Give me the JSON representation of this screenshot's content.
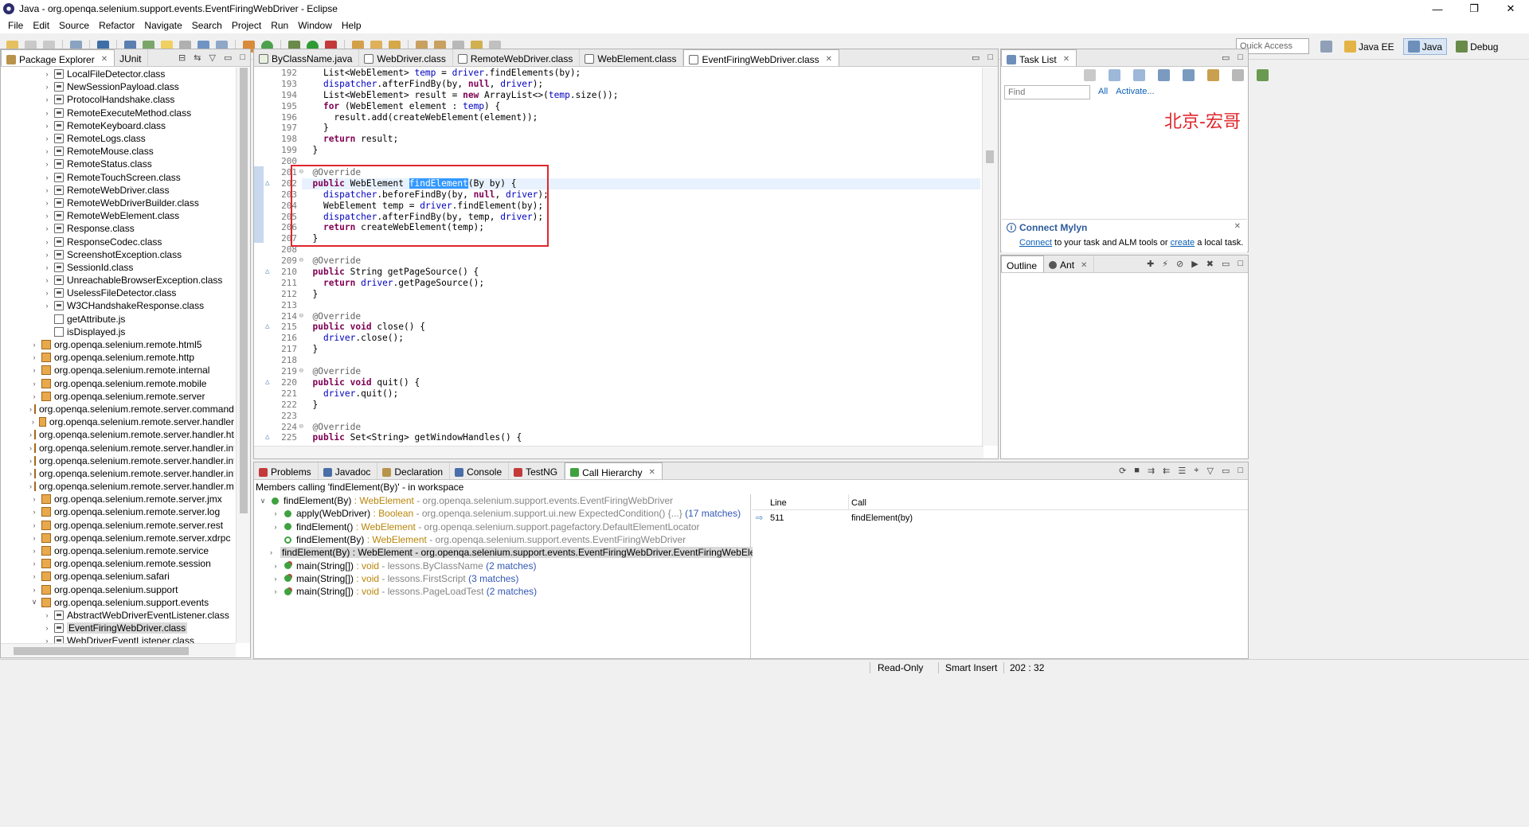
{
  "window": {
    "title": "Java - org.openqa.selenium.support.events.EventFiringWebDriver - Eclipse",
    "buttons": [
      "—",
      "❐",
      "✕"
    ]
  },
  "menu": [
    "File",
    "Edit",
    "Source",
    "Refactor",
    "Navigate",
    "Search",
    "Project",
    "Run",
    "Window",
    "Help"
  ],
  "toolbar": {
    "quick_access_placeholder": "Quick Access",
    "perspectives": [
      "Java EE",
      "Java",
      "Debug"
    ],
    "active_perspective": "Java"
  },
  "package_explorer": {
    "tabs": [
      "Package Explorer",
      "JUnit"
    ],
    "items": [
      {
        "label": "LocalFileDetector.class",
        "kind": "class",
        "indent": 2
      },
      {
        "label": "NewSessionPayload.class",
        "kind": "class",
        "indent": 2
      },
      {
        "label": "ProtocolHandshake.class",
        "kind": "class",
        "indent": 2
      },
      {
        "label": "RemoteExecuteMethod.class",
        "kind": "class",
        "indent": 2
      },
      {
        "label": "RemoteKeyboard.class",
        "kind": "class",
        "indent": 2
      },
      {
        "label": "RemoteLogs.class",
        "kind": "class",
        "indent": 2
      },
      {
        "label": "RemoteMouse.class",
        "kind": "class",
        "indent": 2
      },
      {
        "label": "RemoteStatus.class",
        "kind": "class",
        "indent": 2
      },
      {
        "label": "RemoteTouchScreen.class",
        "kind": "class",
        "indent": 2
      },
      {
        "label": "RemoteWebDriver.class",
        "kind": "class",
        "indent": 2
      },
      {
        "label": "RemoteWebDriverBuilder.class",
        "kind": "class",
        "indent": 2
      },
      {
        "label": "RemoteWebElement.class",
        "kind": "class",
        "indent": 2
      },
      {
        "label": "Response.class",
        "kind": "class",
        "indent": 2
      },
      {
        "label": "ResponseCodec.class",
        "kind": "class",
        "indent": 2
      },
      {
        "label": "ScreenshotException.class",
        "kind": "class",
        "indent": 2
      },
      {
        "label": "SessionId.class",
        "kind": "class",
        "indent": 2
      },
      {
        "label": "UnreachableBrowserException.class",
        "kind": "class",
        "indent": 2
      },
      {
        "label": "UselessFileDetector.class",
        "kind": "class",
        "indent": 2
      },
      {
        "label": "W3CHandshakeResponse.class",
        "kind": "class",
        "indent": 2
      },
      {
        "label": "getAttribute.js",
        "kind": "js",
        "indent": 2
      },
      {
        "label": "isDisplayed.js",
        "kind": "js",
        "indent": 2
      },
      {
        "label": "org.openqa.selenium.remote.html5",
        "kind": "pkg",
        "indent": 1
      },
      {
        "label": "org.openqa.selenium.remote.http",
        "kind": "pkg",
        "indent": 1
      },
      {
        "label": "org.openqa.selenium.remote.internal",
        "kind": "pkg",
        "indent": 1
      },
      {
        "label": "org.openqa.selenium.remote.mobile",
        "kind": "pkg",
        "indent": 1
      },
      {
        "label": "org.openqa.selenium.remote.server",
        "kind": "pkg",
        "indent": 1
      },
      {
        "label": "org.openqa.selenium.remote.server.commandha",
        "kind": "pkg",
        "indent": 1
      },
      {
        "label": "org.openqa.selenium.remote.server.handler",
        "kind": "pkg",
        "indent": 1
      },
      {
        "label": "org.openqa.selenium.remote.server.handler.html",
        "kind": "pkg",
        "indent": 1
      },
      {
        "label": "org.openqa.selenium.remote.server.handler.inter",
        "kind": "pkg",
        "indent": 1
      },
      {
        "label": "org.openqa.selenium.remote.server.handler.inter",
        "kind": "pkg",
        "indent": 1
      },
      {
        "label": "org.openqa.selenium.remote.server.handler.inter",
        "kind": "pkg",
        "indent": 1
      },
      {
        "label": "org.openqa.selenium.remote.server.handler.mob",
        "kind": "pkg",
        "indent": 1
      },
      {
        "label": "org.openqa.selenium.remote.server.jmx",
        "kind": "pkg",
        "indent": 1
      },
      {
        "label": "org.openqa.selenium.remote.server.log",
        "kind": "pkg",
        "indent": 1
      },
      {
        "label": "org.openqa.selenium.remote.server.rest",
        "kind": "pkg",
        "indent": 1
      },
      {
        "label": "org.openqa.selenium.remote.server.xdrpc",
        "kind": "pkg",
        "indent": 1
      },
      {
        "label": "org.openqa.selenium.remote.service",
        "kind": "pkg",
        "indent": 1
      },
      {
        "label": "org.openqa.selenium.remote.session",
        "kind": "pkg",
        "indent": 1
      },
      {
        "label": "org.openqa.selenium.safari",
        "kind": "pkg",
        "indent": 1
      },
      {
        "label": "org.openqa.selenium.support",
        "kind": "pkg",
        "indent": 1
      },
      {
        "label": "org.openqa.selenium.support.events",
        "kind": "pkg",
        "indent": 1,
        "expanded": true
      },
      {
        "label": "AbstractWebDriverEventListener.class",
        "kind": "class",
        "indent": 2
      },
      {
        "label": "EventFiringWebDriver.class",
        "kind": "class",
        "indent": 2,
        "selected": true
      },
      {
        "label": "WebDriverEventListener.class",
        "kind": "class",
        "indent": 2
      }
    ]
  },
  "editor": {
    "tabs": [
      "ByClassName.java",
      "WebDriver.class",
      "RemoteWebDriver.class",
      "WebElement.class",
      "EventFiringWebDriver.class"
    ],
    "active_tab": "EventFiringWebDriver.class",
    "lines": [
      {
        "n": "192",
        "html": "    List&lt;WebElement&gt; <span class='fld'>temp</span> = <span class='fld'>driver</span>.findElements(by);"
      },
      {
        "n": "193",
        "html": "    <span class='fld'>dispatcher</span>.afterFindBy(by, <span class='kw'>null</span>, <span class='fld'>driver</span>);"
      },
      {
        "n": "194",
        "html": "    List&lt;WebElement&gt; result = <span class='kw'>new</span> ArrayList&lt;&gt;(<span class='fld'>temp</span>.size());"
      },
      {
        "n": "195",
        "html": "    <span class='kw'>for</span> (WebElement element : <span class='fld'>temp</span>) {"
      },
      {
        "n": "196",
        "html": "      result.add(createWebElement(element));"
      },
      {
        "n": "197",
        "html": "    }"
      },
      {
        "n": "198",
        "html": "    <span class='kw'>return</span> result;"
      },
      {
        "n": "199",
        "html": "  }"
      },
      {
        "n": "200",
        "html": ""
      },
      {
        "n": "201",
        "html": "  <span class='ann'>@Override</span>",
        "fold": true
      },
      {
        "n": "202",
        "html": "  <span class='kw'>public</span> WebElement <span class='sel'>findElement</span>(By by) {",
        "current": true,
        "mark": true
      },
      {
        "n": "203",
        "html": "    <span class='fld'>dispatcher</span>.beforeFindBy(by, <span class='kw'>null</span>, <span class='fld'>driver</span>);"
      },
      {
        "n": "204",
        "html": "    WebElement temp = <span class='fld'>driver</span>.findElement(by);"
      },
      {
        "n": "205",
        "html": "    <span class='fld'>dispatcher</span>.afterFindBy(by, temp, <span class='fld'>driver</span>);"
      },
      {
        "n": "206",
        "html": "    <span class='kw'>return</span> createWebElement(temp);"
      },
      {
        "n": "207",
        "html": "  }"
      },
      {
        "n": "208",
        "html": ""
      },
      {
        "n": "209",
        "html": "  <span class='ann'>@Override</span>",
        "fold": true
      },
      {
        "n": "210",
        "html": "  <span class='kw'>public</span> String getPageSource() {",
        "mark": true
      },
      {
        "n": "211",
        "html": "    <span class='kw'>return</span> <span class='fld'>driver</span>.getPageSource();"
      },
      {
        "n": "212",
        "html": "  }"
      },
      {
        "n": "213",
        "html": ""
      },
      {
        "n": "214",
        "html": "  <span class='ann'>@Override</span>",
        "fold": true
      },
      {
        "n": "215",
        "html": "  <span class='kw'>public</span> <span class='kw'>void</span> close() {",
        "mark": true
      },
      {
        "n": "216",
        "html": "    <span class='fld'>driver</span>.close();"
      },
      {
        "n": "217",
        "html": "  }"
      },
      {
        "n": "218",
        "html": ""
      },
      {
        "n": "219",
        "html": "  <span class='ann'>@Override</span>",
        "fold": true
      },
      {
        "n": "220",
        "html": "  <span class='kw'>public</span> <span class='kw'>void</span> quit() {",
        "mark": true
      },
      {
        "n": "221",
        "html": "    <span class='fld'>driver</span>.quit();"
      },
      {
        "n": "222",
        "html": "  }"
      },
      {
        "n": "223",
        "html": ""
      },
      {
        "n": "224",
        "html": "  <span class='ann'>@Override</span>",
        "fold": true
      },
      {
        "n": "225",
        "html": "  <span class='kw'>public</span> Set&lt;String&gt; getWindowHandles() {",
        "mark": true
      }
    ]
  },
  "task_list": {
    "tab": "Task List",
    "find_placeholder": "Find",
    "all_label": "All",
    "activate_label": "Activate..."
  },
  "watermark": "北京-宏哥",
  "mylyn": {
    "title": "Connect Mylyn",
    "connect_link": "Connect",
    "middle_text": " to your task and ALM tools or ",
    "create_link": "create",
    "end_text": " a local task."
  },
  "outline": {
    "tabs": [
      "Outline",
      "Ant"
    ]
  },
  "bottom_panel": {
    "tabs": [
      "Problems",
      "Javadoc",
      "Declaration",
      "Console",
      "TestNG",
      "Call Hierarchy"
    ],
    "active_tab": "Call Hierarchy",
    "header": "Members calling 'findElement(By)' - in workspace",
    "rows": [
      {
        "arrow": "∨",
        "method": "findElement(By)",
        "type": " : WebElement",
        "pkg": " - org.openqa.selenium.support.events.EventFiringWebDriver",
        "matches": "",
        "level": 0,
        "icon": "green"
      },
      {
        "arrow": "›",
        "method": "apply(WebDriver)",
        "type": " : Boolean",
        "pkg": " - org.openqa.selenium.support.ui.new ExpectedCondition() {...}",
        "matches": " (17 matches)",
        "level": 1,
        "icon": "green"
      },
      {
        "arrow": "›",
        "method": "findElement()",
        "type": " : WebElement",
        "pkg": " - org.openqa.selenium.support.pagefactory.DefaultElementLocator",
        "matches": "",
        "level": 1,
        "icon": "green"
      },
      {
        "arrow": "",
        "method": "findElement(By)",
        "type": " : WebElement",
        "pkg": " - org.openqa.selenium.support.events.EventFiringWebDriver",
        "matches": "",
        "level": 1,
        "icon": "recursive"
      },
      {
        "arrow": "›",
        "method": "findElement(By)",
        "type": " : WebElement",
        "pkg": " - org.openqa.selenium.support.events.EventFiringWebDriver.EventFiringWebElement",
        "matches": "",
        "level": 1,
        "icon": "green",
        "selected": true
      },
      {
        "arrow": "›",
        "method": "main(String[])",
        "type": " : void",
        "pkg": " - lessons.ByClassName",
        "matches": " (2 matches)",
        "level": 1,
        "icon": "static"
      },
      {
        "arrow": "›",
        "method": "main(String[])",
        "type": " : void",
        "pkg": " - lessons.FirstScript",
        "matches": " (3 matches)",
        "level": 1,
        "icon": "static"
      },
      {
        "arrow": "›",
        "method": "main(String[])",
        "type": " : void",
        "pkg": " - lessons.PageLoadTest",
        "matches": " (2 matches)",
        "level": 1,
        "icon": "static"
      }
    ],
    "col_line": "Line",
    "col_call": "Call",
    "line_value": "511",
    "call_value": "findElement(by)"
  },
  "status": {
    "mode": "Read-Only",
    "insert": "Smart Insert",
    "position": "202 : 32"
  },
  "colors": {
    "highlight_box": "#e0262c",
    "watermark": "#e0262c",
    "selection": "#3399ff",
    "keyword": "#7f0055",
    "field": "#0000c0"
  }
}
